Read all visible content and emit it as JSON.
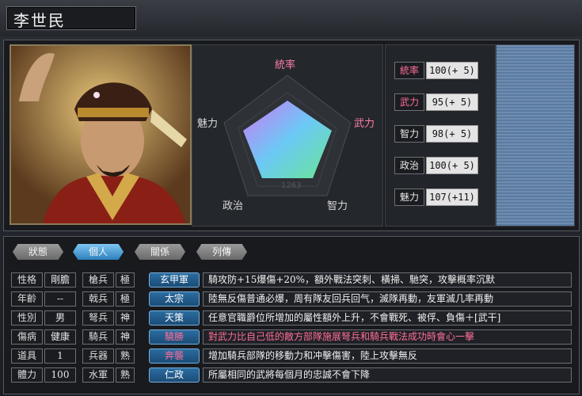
{
  "character": {
    "name": "李世民"
  },
  "radar": {
    "labels": {
      "tong": "統率",
      "wu": "武力",
      "zhi": "智力",
      "zheng": "政治",
      "mei": "魅力"
    },
    "levels": {
      "tong": 1.0,
      "wu": 0.95,
      "zhi": 0.98,
      "zheng": 1.0,
      "mei": 1.0
    }
  },
  "stats": [
    {
      "name": "統率",
      "value": "100(+ 5)",
      "highlight": true
    },
    {
      "name": "武力",
      "value": " 95(+ 5)",
      "highlight": true
    },
    {
      "name": "智力",
      "value": " 98(+ 5)",
      "highlight": false
    },
    {
      "name": "政治",
      "value": "100(+ 5)",
      "highlight": false
    },
    {
      "name": "魅力",
      "value": "107(+11)",
      "highlight": false
    }
  ],
  "tabs": [
    {
      "label": "狀態",
      "active": false
    },
    {
      "label": "個人",
      "active": true
    },
    {
      "label": "關係",
      "active": false
    },
    {
      "label": "列傳",
      "active": false
    }
  ],
  "profile": [
    {
      "label": "性格",
      "value": "剛膽"
    },
    {
      "label": "年齡",
      "value": "--"
    },
    {
      "label": "性別",
      "value": "男"
    },
    {
      "label": "傷病",
      "value": "健康"
    },
    {
      "label": "道具",
      "value": "1"
    },
    {
      "label": "體力",
      "value": "100"
    }
  ],
  "aptitudes": [
    {
      "label": "槍兵",
      "value": "極"
    },
    {
      "label": "戟兵",
      "value": "極"
    },
    {
      "label": "弩兵",
      "value": "神"
    },
    {
      "label": "騎兵",
      "value": "神"
    },
    {
      "label": "兵器",
      "value": "熟"
    },
    {
      "label": "水軍",
      "value": "熟"
    }
  ],
  "skills": [
    {
      "name": "玄甲軍",
      "desc": "騎攻防+15爆傷+20%，額外戰法突刺、橫掃、馳突，攻擊概率沉默",
      "red": false
    },
    {
      "name": "太宗",
      "desc": "陸無反傷普通必爆，周有隊友回兵回气，滅隊再動，友軍滅几率再動",
      "red": false
    },
    {
      "name": "天策",
      "desc": "任意官職爵位所增加的屬性額外上升，不會戰死、被俘、負傷＋[武干]",
      "red": false
    },
    {
      "name": "驍勝",
      "desc": "對武力比自己低的敵方部隊施展弩兵和騎兵戰法成功時會心一擊",
      "red": true
    },
    {
      "name": "奔襲",
      "desc": "增加騎兵部隊的移動力和冲擊傷害，陸上攻擊無反",
      "red": true
    },
    {
      "name": "仁政",
      "desc": "所屬相同的武將每個月的忠誠不會下降",
      "red": false
    }
  ],
  "colors": {
    "accent": "#2c80bd",
    "highlight": "#ff6e98"
  }
}
